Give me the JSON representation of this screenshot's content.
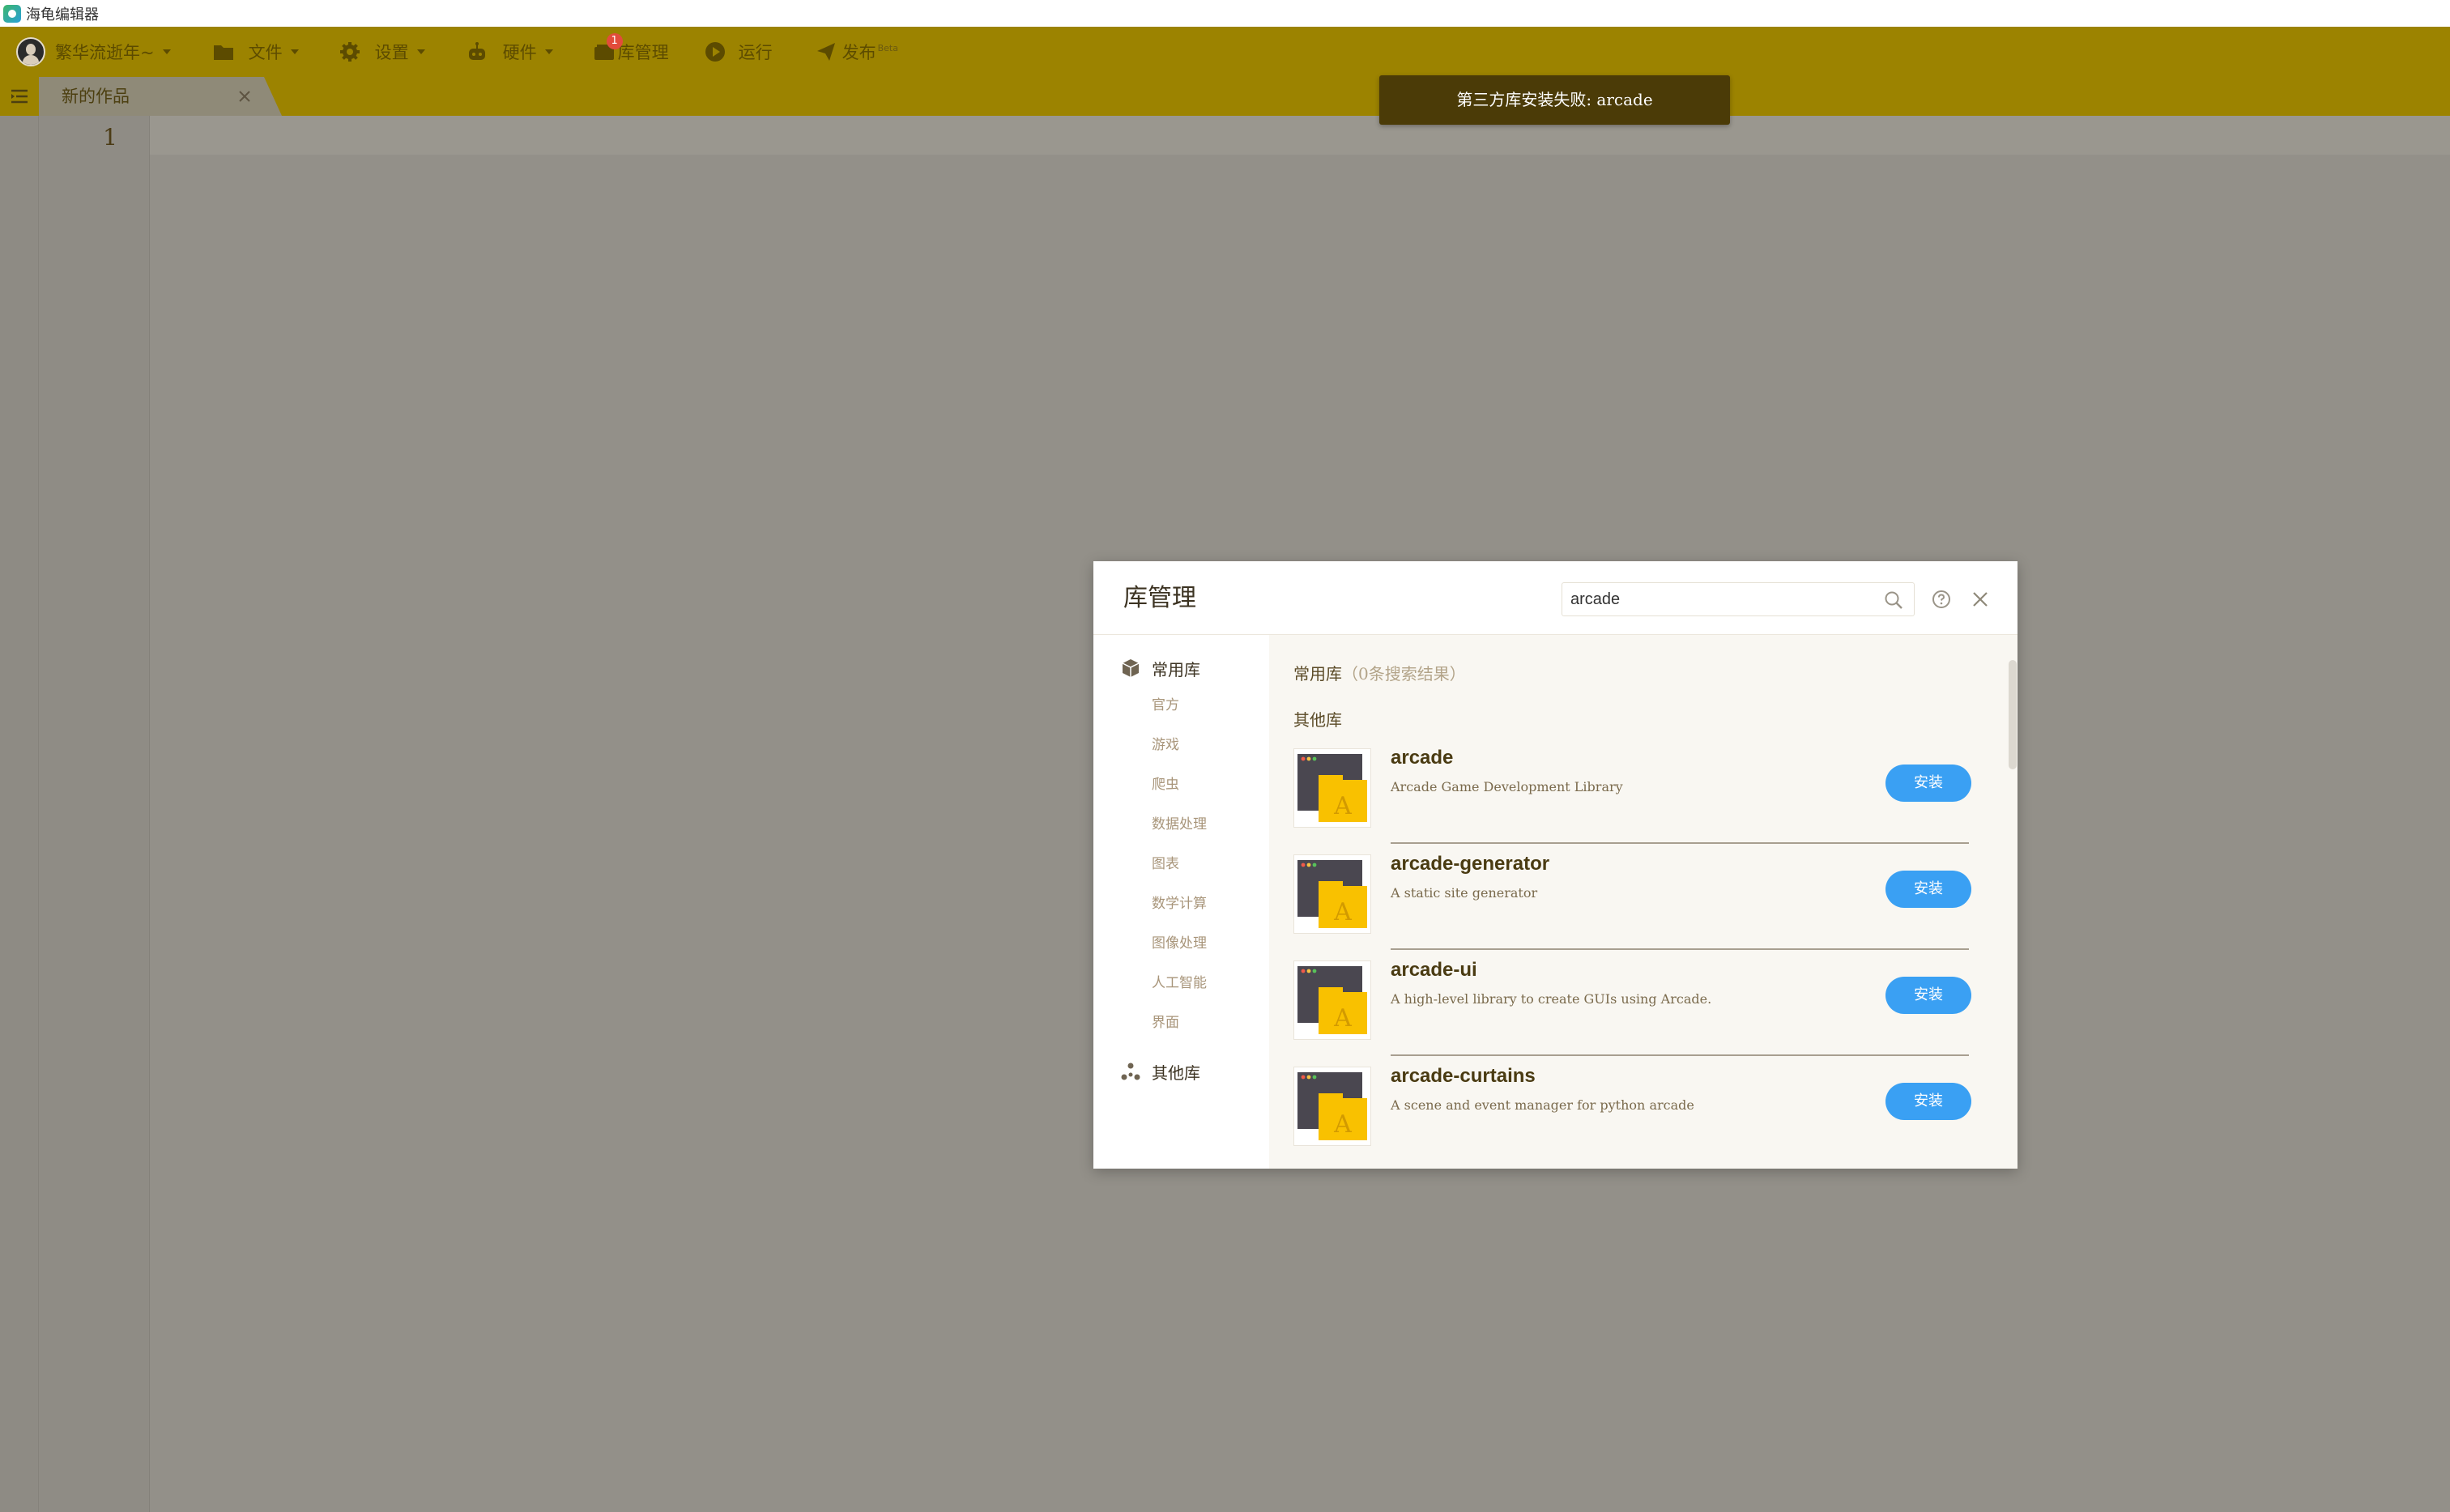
{
  "window": {
    "title": "海龟编辑器"
  },
  "menubar": {
    "user": "繁华流逝年~",
    "file": "文件",
    "settings": "设置",
    "hardware": "硬件",
    "library": "库管理",
    "library_badge": "1",
    "run": "运行",
    "publish": "发布",
    "publish_tag": "Beta"
  },
  "tabs": [
    {
      "label": "新的作品"
    }
  ],
  "editor": {
    "line_numbers": [
      "1"
    ]
  },
  "toast": {
    "message": "第三方库安装失败: arcade"
  },
  "modal": {
    "title": "库管理",
    "search": {
      "value": "arcade"
    },
    "sidebar": {
      "common": {
        "label": "常用库",
        "subitems": [
          "官方",
          "游戏",
          "爬虫",
          "数据处理",
          "图表",
          "数学计算",
          "图像处理",
          "人工智能",
          "界面"
        ]
      },
      "other": {
        "label": "其他库"
      }
    },
    "content": {
      "common_section": {
        "title": "常用库",
        "count_text": "（0条搜索结果）"
      },
      "other_section": {
        "title": "其他库"
      },
      "install_label": "安装",
      "libraries": [
        {
          "name": "arcade",
          "description": "Arcade Game Development Library",
          "icon_letter": "A"
        },
        {
          "name": "arcade-generator",
          "description": "A static site generator",
          "icon_letter": "A"
        },
        {
          "name": "arcade-ui",
          "description": "A high-level library to create GUIs using Arcade.",
          "icon_letter": "A"
        },
        {
          "name": "arcade-curtains",
          "description": "A scene and event manager for python arcade",
          "icon_letter": "A"
        }
      ]
    }
  },
  "colors": {
    "menubar_bg": "#9c8300",
    "toast_bg": "#4b3b07",
    "install_button": "#3aa0f3",
    "overlay": "#939089"
  }
}
